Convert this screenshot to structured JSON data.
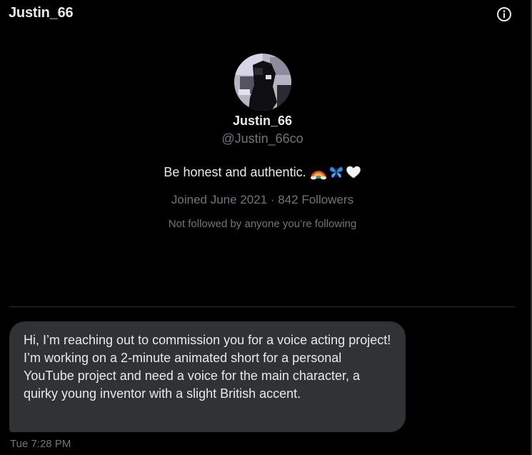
{
  "header": {
    "title": "Justin_66",
    "info_icon": "info-circle-icon"
  },
  "profile": {
    "avatar_icon": "user-avatar",
    "display_name": "Justin_66",
    "handle": "@Justin_66co",
    "bio_text": "Be honest and authentic.",
    "bio_emojis": [
      "rainbow-icon",
      "butterfly-icon",
      "white-heart-icon"
    ],
    "joined": "Joined June 2021",
    "separator": " · ",
    "followers": "842 Followers",
    "mutual_status": "Not followed by anyone you’re following"
  },
  "messages": [
    {
      "text": "Hi, I’m reaching out to commission you for a voice acting project! I’m working on a 2-minute animated short for a personal YouTube project and need a voice for the main character, a quirky young inventor with a slight British accent.",
      "time": "Tue 7:28 PM"
    }
  ],
  "colors": {
    "background": "#000000",
    "text_primary": "#e7e9ea",
    "text_secondary": "#71767b",
    "bubble": "#2f3336",
    "divider": "#2f3336"
  }
}
